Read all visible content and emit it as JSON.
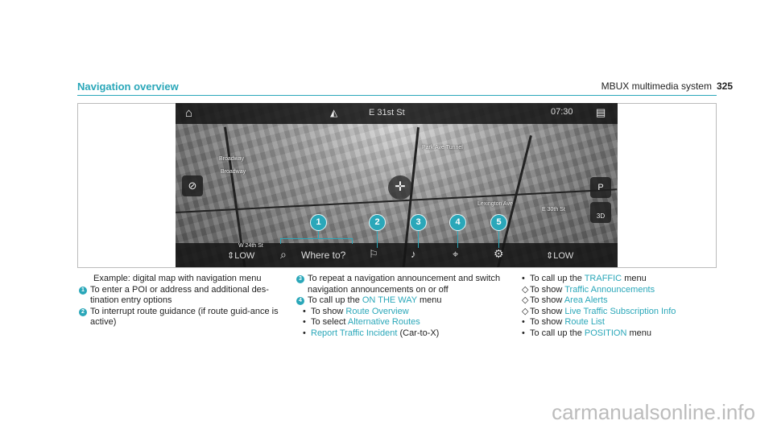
{
  "header": {
    "section": "MBUX multimedia system",
    "page": "325"
  },
  "section_title": "Navigation overview",
  "map": {
    "street_top": "E 31st St",
    "time": "07:30",
    "streets": [
      "Broadway",
      "Broadway",
      "Park Ave Tunnel",
      "Lexington Ave",
      "E 30th St",
      "W 24th St"
    ],
    "left_level": "LOW",
    "right_level": "LOW",
    "search_label": "Where to?",
    "park_label": "P",
    "view_label": "3D",
    "callouts": [
      "1",
      "2",
      "3",
      "4",
      "5"
    ]
  },
  "caption": "Example: digital map with navigation menu",
  "col1": [
    {
      "n": "1",
      "text": "To enter a POI or address and additional des-tination entry options"
    },
    {
      "n": "2",
      "text": "To interrupt route guidance (if route guid-ance is active)"
    }
  ],
  "col2": {
    "item3": {
      "n": "3",
      "text": "To repeat a navigation announcement and switch navigation announcements on or off"
    },
    "item4": {
      "n": "4",
      "pre": "To call up the ",
      "link": "ON THE WAY",
      "post": " menu"
    },
    "subs": [
      {
        "mark": "•",
        "pre": "To show ",
        "link": "Route Overview",
        "post": ""
      },
      {
        "mark": "•",
        "pre": "To select ",
        "link": "Alternative Routes",
        "post": ""
      },
      {
        "mark": "•",
        "pre": "",
        "link": "Report Traffic Incident",
        "post": " (Car-to-X)"
      }
    ]
  },
  "col3": [
    {
      "mark": "•",
      "pre": "To call up the ",
      "link": "TRAFFIC",
      "post": " menu"
    },
    {
      "mark": "◇",
      "pre": "To show ",
      "link": "Traffic Announcements",
      "post": ""
    },
    {
      "mark": "◇",
      "pre": "To show ",
      "link": "Area Alerts",
      "post": ""
    },
    {
      "mark": "◇",
      "pre": "To show ",
      "link": "Live Traffic Subscription Info",
      "post": ""
    },
    {
      "mark": "•",
      "pre": "To show ",
      "link": "Route List",
      "post": ""
    },
    {
      "mark": "•",
      "pre": "To call up the ",
      "link": "POSITION",
      "post": " menu"
    }
  ],
  "watermark": "carmanualsonline.info",
  "colors": {
    "accent": "#2aa7b9",
    "bar": "#141414"
  }
}
